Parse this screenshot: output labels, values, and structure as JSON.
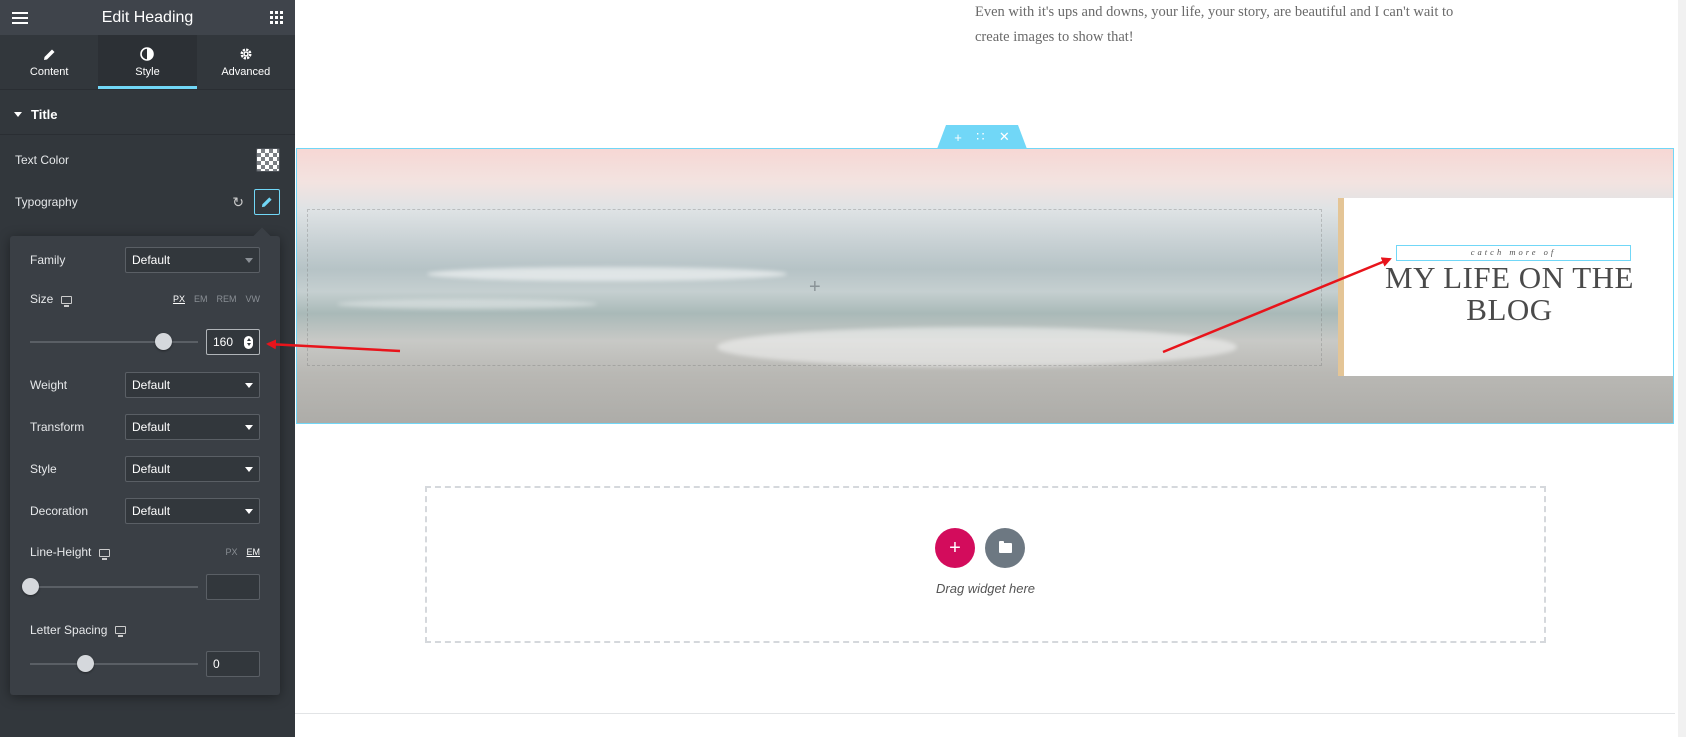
{
  "header": {
    "title": "Edit Heading"
  },
  "tabs": [
    {
      "label": "Content",
      "icon": "pencil-icon"
    },
    {
      "label": "Style",
      "icon": "contrast-icon"
    },
    {
      "label": "Advanced",
      "icon": "gear-icon"
    }
  ],
  "section": {
    "title": "Title"
  },
  "controls": {
    "text_color_label": "Text Color",
    "typography_label": "Typography"
  },
  "typography": {
    "family_label": "Family",
    "family_value": "Default",
    "size_label": "Size",
    "size_units": [
      "PX",
      "EM",
      "REM",
      "VW"
    ],
    "size_value": "160",
    "weight_label": "Weight",
    "weight_value": "Default",
    "transform_label": "Transform",
    "transform_value": "Default",
    "style_label": "Style",
    "style_value": "Default",
    "decoration_label": "Decoration",
    "decoration_value": "Default",
    "line_height_label": "Line-Height",
    "line_height_units": [
      "PX",
      "EM"
    ],
    "line_height_value": "",
    "letter_spacing_label": "Letter Spacing",
    "letter_spacing_value": "0"
  },
  "canvas": {
    "intro_text": "Even with it's ups and downs, your life, your story, are beautiful and I can't wait to create images to show that!",
    "catch_text": "catch more of",
    "blog_title": "MY LIFE ON THE BLOG",
    "drag_text": "Drag widget here"
  },
  "colors": {
    "accent": "#71d7f7",
    "add_button": "#d30c5c",
    "annotation_arrow": "#e8141b"
  }
}
